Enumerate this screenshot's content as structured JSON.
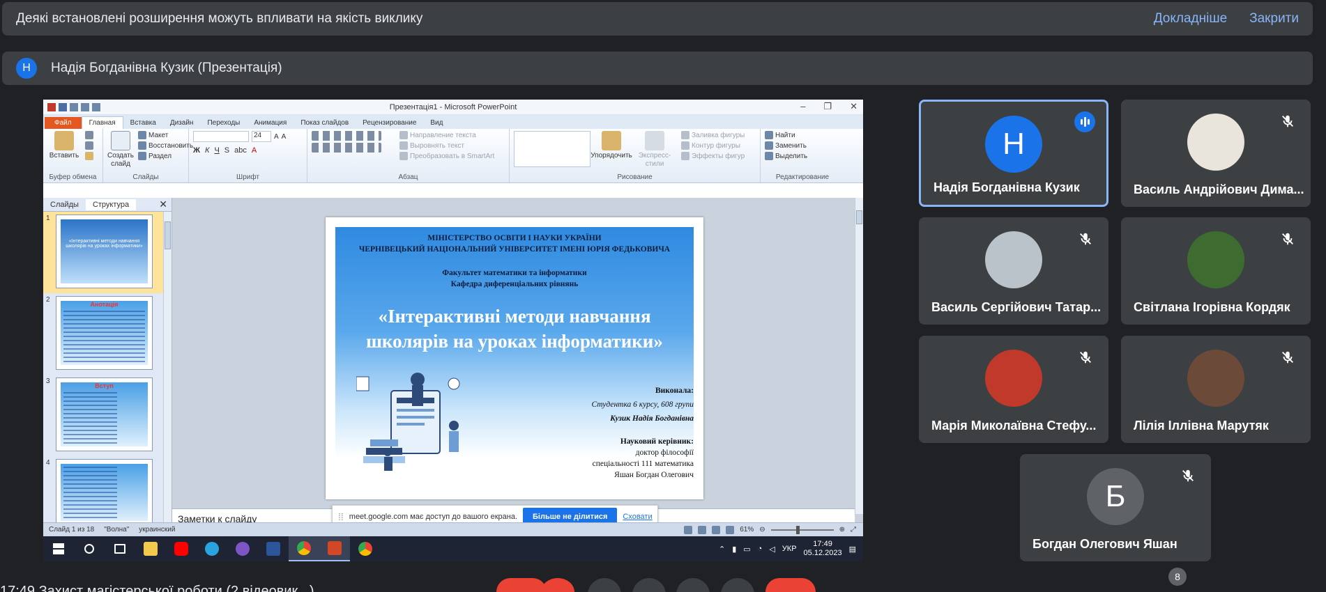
{
  "banner": {
    "text": "Деякі встановлені розширення можуть впливати на якість виклику",
    "details": "Докладніше",
    "close": "Закрити"
  },
  "presenter": {
    "initial": "Н",
    "label": "Надія Богданівна Кузик (Презентація)"
  },
  "powerpoint": {
    "title": "Презентація1 - Microsoft PowerPoint",
    "tabs": [
      "Файл",
      "Главная",
      "Вставка",
      "Дизайн",
      "Переходы",
      "Анимация",
      "Показ слайдов",
      "Рецензирование",
      "Вид"
    ],
    "ribbon": {
      "clipboard": {
        "paste": "Вставить",
        "label": "Буфер обмена"
      },
      "slides": {
        "create": "Создать слайд",
        "layout": "Макет",
        "reset": "Восстановить",
        "section": "Раздел",
        "label": "Слайды"
      },
      "font": {
        "size": "24",
        "label": "Шрифт"
      },
      "paragraph": {
        "direction": "Направление текста",
        "align": "Выровнять текст",
        "smartart": "Преобразовать в SmartArt",
        "label": "Абзац"
      },
      "drawing": {
        "arrange": "Упорядочить",
        "quickstyles": "Экспресс-стили",
        "fill": "Заливка фигуры",
        "outline": "Контур фигуры",
        "effects": "Эффекты фигур",
        "label": "Рисование"
      },
      "editing": {
        "find": "Найти",
        "replace": "Заменить",
        "select": "Выделить",
        "label": "Редактирование"
      }
    },
    "pane_tabs": {
      "slides": "Слайды",
      "outline": "Структура"
    },
    "thumbs": [
      {
        "num": "1",
        "text": "«Інтерактивні методи навчання школярів на уроках інформатики»"
      },
      {
        "num": "2",
        "text": "Анотація"
      },
      {
        "num": "3",
        "text": "Вступ"
      },
      {
        "num": "4",
        "text": ""
      }
    ],
    "slide": {
      "ministry": [
        "МІНІСТЕРСТВО ОСВІТИ І НАУКИ УКРАЇНИ",
        "ЧЕРНІВЕЦЬКИЙ НАЦІОНАЛЬНИЙ УНІВЕРСИТЕТ ІМЕНІ ЮРІЯ ФЕДЬКОВИЧА"
      ],
      "faculty": [
        "Факультет математики та інформатики",
        "Кафедра диференціальних рівнянь"
      ],
      "title": [
        "«Інтерактивні методи навчання",
        "школярів на уроках інформатики»"
      ],
      "performed_label": "Виконала:",
      "student": "Студентка 6 курсу, 608 групи",
      "student_name": "Кузик Надія Богданівна",
      "advisor_label": "Науковий керівник:",
      "advisor_lines": [
        "доктор філософії",
        "спеціальності 111 математика",
        "Яшан Богдан Олегович"
      ]
    },
    "notes_placeholder": "Заметки к слайду",
    "status": {
      "slide": "Слайд 1 из 18",
      "theme": "\"Волна\"",
      "lang": "украинский",
      "zoom": "61%"
    }
  },
  "share_notice": {
    "text": "meet.google.com має доступ до вашого екрана.",
    "stop": "Більше не ділитися",
    "hide": "Сховати"
  },
  "taskbar": {
    "lang": "УКР",
    "time": "17:49",
    "date": "05.12.2023"
  },
  "participants": [
    {
      "name": "Надія Богданівна Кузик",
      "initial": "Н",
      "speaking": true,
      "avatar_color": "#1a73e8"
    },
    {
      "name": "Василь Андрійович Дима...",
      "initial": "",
      "speaking": false,
      "avatar_color": "#e9e4dc"
    },
    {
      "name": "Василь Сергійович Татар...",
      "initial": "",
      "speaking": false,
      "avatar_color": "#b9c3c9"
    },
    {
      "name": "Світлана Ігорівна Кордяк",
      "initial": "",
      "speaking": false,
      "avatar_color": "#3e6b2f"
    },
    {
      "name": "Марія Миколаївна Стефу...",
      "initial": "",
      "speaking": false,
      "avatar_color": "#c0392b"
    },
    {
      "name": "Лілія Іллівна Марутяк",
      "initial": "",
      "speaking": false,
      "avatar_color": "#6b4a3a"
    },
    {
      "name": "Богдан Олегович Яшан",
      "initial": "Б",
      "speaking": false,
      "avatar_color": "#5f6368"
    }
  ],
  "meeting": {
    "participant_count": "8",
    "bottom_text": "17:49  Захист магістерської роботи (2 відеовик...)"
  }
}
